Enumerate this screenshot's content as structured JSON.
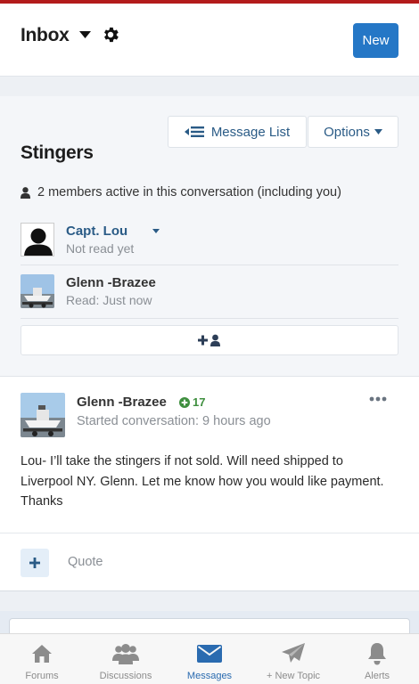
{
  "header": {
    "title": "Inbox",
    "new_label": "New",
    "accent": "#2577c6",
    "stripe_color": "#b31b1b"
  },
  "conversation": {
    "message_list_label": "Message List",
    "options_label": "Options",
    "title": "Stingers",
    "members_text": "2 members active in this conversation (including you)",
    "members": [
      {
        "name": "Capt. Lou",
        "status": "Not read yet",
        "avatar": "default-avatar"
      },
      {
        "name": "Glenn -Brazee",
        "status": "Read: Just now",
        "avatar": "boat-photo"
      }
    ]
  },
  "post": {
    "author": "Glenn -Brazee",
    "reputation": "17",
    "meta": "Started conversation: 9 hours ago",
    "body": "Lou- I’ll take the stingers if not sold. Will need shipped to Liverpool NY. Glenn. Let me know how you would like payment. Thanks",
    "quote_label": "Quote"
  },
  "tabbar": {
    "tabs": [
      {
        "label": "Forums",
        "icon": "home-icon"
      },
      {
        "label": "Discussions",
        "icon": "users-icon"
      },
      {
        "label": "Messages",
        "icon": "envelope-icon",
        "active": true
      },
      {
        "label": "+ New Topic",
        "icon": "paper-plane-icon"
      },
      {
        "label": "Alerts",
        "icon": "bell-icon"
      }
    ]
  }
}
